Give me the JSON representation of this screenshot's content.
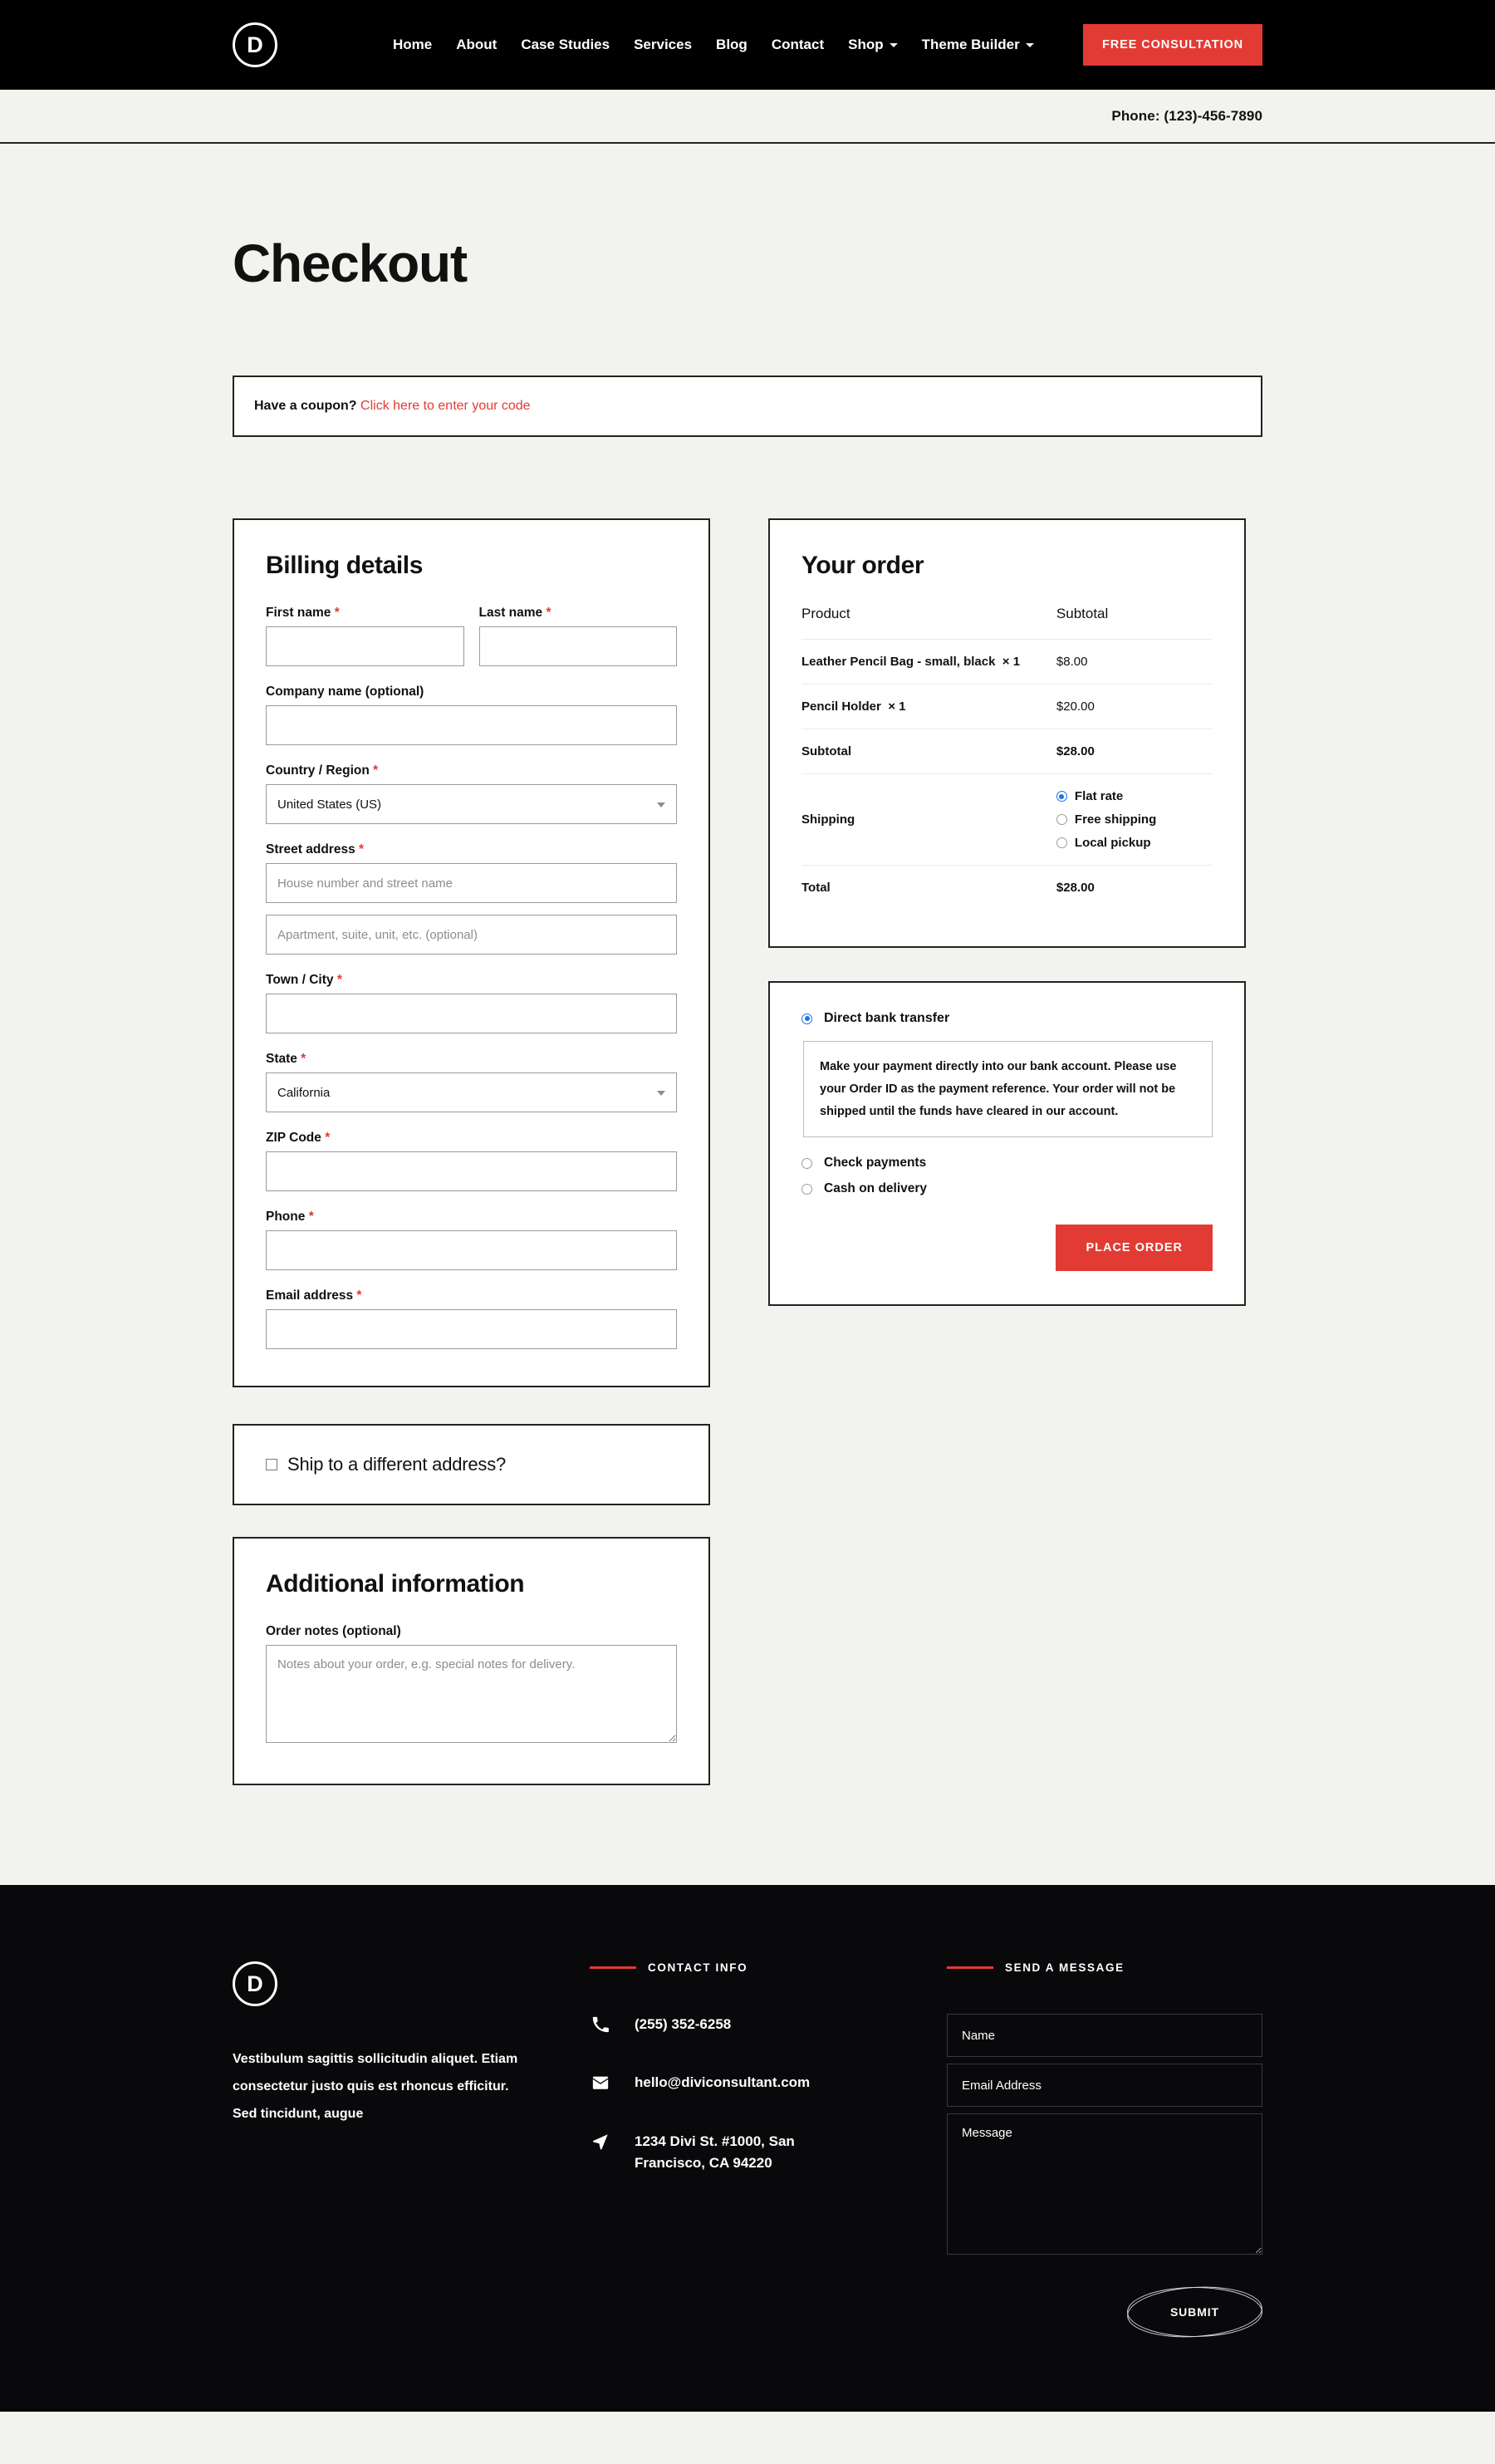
{
  "header": {
    "logo_letter": "D",
    "nav_items": [
      {
        "label": "Home",
        "has_caret": false
      },
      {
        "label": "About",
        "has_caret": false
      },
      {
        "label": "Case Studies",
        "has_caret": false
      },
      {
        "label": "Services",
        "has_caret": false
      },
      {
        "label": "Blog",
        "has_caret": false
      },
      {
        "label": "Contact",
        "has_caret": false
      },
      {
        "label": "Shop",
        "has_caret": true
      },
      {
        "label": "Theme Builder",
        "has_caret": true
      }
    ],
    "cta_label": "FREE CONSULTATION",
    "cta_color": "#e23b33",
    "phone_text": "Phone: (123)-456-7890"
  },
  "page": {
    "title": "Checkout"
  },
  "coupon": {
    "prompt": "Have a coupon?",
    "link": "Click here to enter your code",
    "link_color": "#e23b33"
  },
  "billing": {
    "title": "Billing details",
    "first_name": {
      "label": "First name",
      "required": "*",
      "value": ""
    },
    "last_name": {
      "label": "Last name",
      "required": "*",
      "value": ""
    },
    "company": {
      "label": "Company name (optional)",
      "value": ""
    },
    "country": {
      "label": "Country / Region",
      "required": "*",
      "value": "United States (US)"
    },
    "street": {
      "label": "Street address",
      "required": "*",
      "line1_placeholder": "House number and street name",
      "line2_placeholder": "Apartment, suite, unit, etc. (optional)",
      "line1_value": "",
      "line2_value": ""
    },
    "city": {
      "label": "Town / City",
      "required": "*",
      "value": ""
    },
    "state": {
      "label": "State",
      "required": "*",
      "value": "California"
    },
    "zip": {
      "label": "ZIP Code",
      "required": "*",
      "value": ""
    },
    "phone": {
      "label": "Phone",
      "required": "*",
      "value": ""
    },
    "email": {
      "label": "Email address",
      "required": "*",
      "value": ""
    }
  },
  "shipping_toggle": {
    "label": "Ship to a different address?",
    "checked": false
  },
  "additional": {
    "title": "Additional information",
    "notes_label": "Order notes (optional)",
    "notes_placeholder": "Notes about your order, e.g. special notes for delivery.",
    "notes_value": ""
  },
  "order": {
    "title": "Your order",
    "col_product": "Product",
    "col_subtotal": "Subtotal",
    "items": [
      {
        "name": "Leather Pencil Bag - small, black",
        "qty": "× 1",
        "amount": "$8.00"
      },
      {
        "name": "Pencil Holder",
        "qty": "× 1",
        "amount": "$20.00"
      }
    ],
    "subtotal_label": "Subtotal",
    "subtotal_value": "$28.00",
    "shipping_label": "Shipping",
    "shipping_options": [
      {
        "label": "Flat rate",
        "selected": true
      },
      {
        "label": "Free shipping",
        "selected": false
      },
      {
        "label": "Local pickup",
        "selected": false
      }
    ],
    "total_label": "Total",
    "total_value": "$28.00",
    "radio_accent": "#1a73e8"
  },
  "payment": {
    "methods": [
      {
        "label": "Direct bank transfer",
        "selected": true
      },
      {
        "label": "Check payments",
        "selected": false
      },
      {
        "label": "Cash on delivery",
        "selected": false
      }
    ],
    "note": "Make your payment directly into our bank account. Please use your Order ID as the payment reference. Your order will not be shipped until the funds have cleared in our account.",
    "place_order_label": "PLACE ORDER",
    "place_order_color": "#e23b33"
  },
  "footer": {
    "logo_letter": "D",
    "blurb": "Vestibulum sagittis sollicitudin aliquet. Etiam consectetur justo quis est rhoncus efficitur. Sed tincidunt, augue",
    "contact": {
      "heading": "CONTACT INFO",
      "accent": "#e23b33",
      "rows": [
        {
          "icon": "phone-icon",
          "text": "(255) 352-6258"
        },
        {
          "icon": "envelope-icon",
          "text": "hello@diviconsultant.com"
        },
        {
          "icon": "location-arrow-icon",
          "text": "1234 Divi St. #1000, San Francisco, CA 94220"
        }
      ]
    },
    "message": {
      "heading": "SEND A MESSAGE",
      "name_placeholder": "Name",
      "email_placeholder": "Email Address",
      "message_placeholder": "Message",
      "name_value": "",
      "email_value": "",
      "message_value": "",
      "submit_label": "SUBMIT"
    }
  }
}
